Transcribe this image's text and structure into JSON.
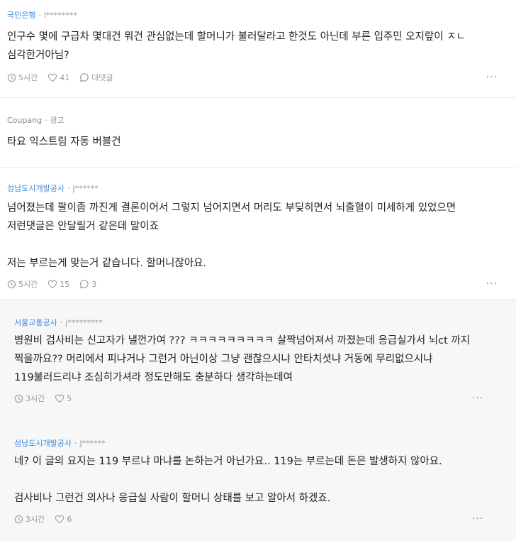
{
  "comments": [
    {
      "company": "국민은행",
      "author": "l********",
      "text": "인구수 몇에 구급차 몇대건 뭐건 관심없는데 할머니가 불러달라고 한것도 아닌데 부른 입주민 오지랖이 ㅈㄴ 심각한거아님?",
      "time": "5시간",
      "likes": "41",
      "reply_label": "대댓글"
    },
    {
      "company": "Coupang",
      "author": "광고",
      "text": "타요 익스트림 자동 버블건"
    },
    {
      "company": "성남도시개발공사",
      "author": "J******",
      "text": "넘어졌는데 팔이좀 까진게 결론이어서 그렇지 넘어지면서 머리도 부딪히면서 뇌출혈이 미세하게 있었으면 저런댓글은 안달릴거 같은데 말이죠\n\n저는 부르는게 맞는거 같습니다. 할머니잖아요.",
      "time": "5시간",
      "likes": "15",
      "replies": "3"
    },
    {
      "company": "서울교통공사",
      "author": "j*********",
      "text": "병원비 검사비는 신고자가 낼껀가여 ??? ㅋㅋㅋㅋㅋㅋㅋㅋㅋ 살짝넘어져서 까졌는데 응급실가서 뇌ct 까지 찍을까요?? 머리에서 피나거나 그런거 아닌이상 그냥 괜찮으시냐 안타치셧냐 거동에 무리없으시냐 119불러드리냐 조심히가셔라 정도만해도 충분하다 생각하는데여",
      "time": "3시간",
      "likes": "5"
    },
    {
      "company": "성남도시개발공사",
      "author": "J******",
      "text": "네? 이 글의 요지는 119 부르냐 마냐를 논하는거 아닌가요.. 119는 부르는데 돈은 발생하지 않아요.\n\n검사비나 그런건 의사나 응급실 사람이 할머니 상태를 보고 알아서 하겠죠.",
      "time": "3시간",
      "likes": "6"
    }
  ],
  "colors": {
    "company": "#3b8ad9",
    "muted": "#9a9a9a",
    "reply_bg": "#f7f7f8"
  }
}
